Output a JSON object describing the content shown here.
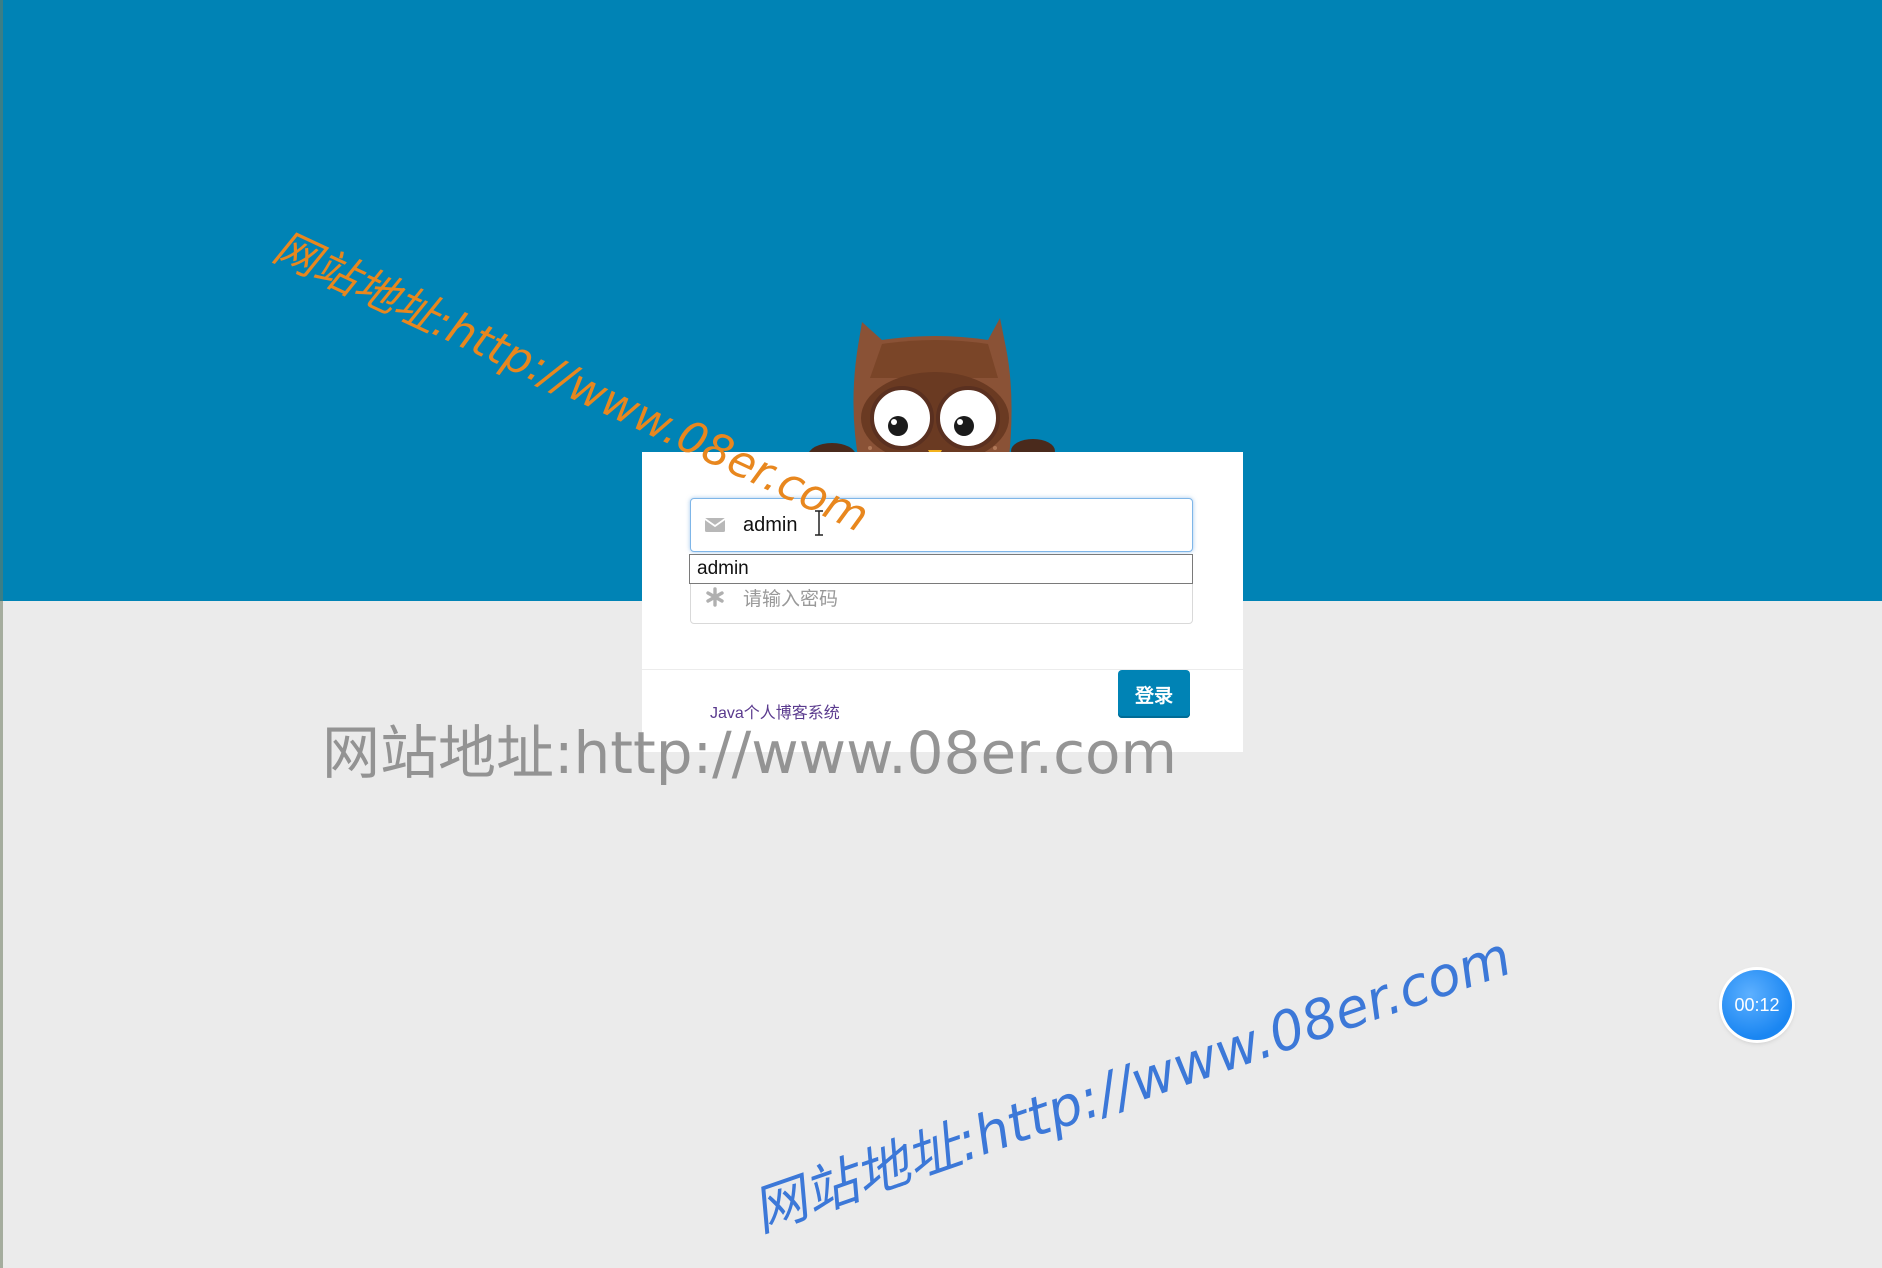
{
  "login_form": {
    "username_value": "admin",
    "password_placeholder": "请输入密码",
    "autocomplete_suggestion": "admin",
    "footer_link": "Java个人博客系统",
    "login_button": "登录"
  },
  "watermarks": {
    "orange": "网站地址:http://www.08er.com",
    "gray": "网站地址:http://www.08er.com",
    "blue": "网站地址:http://www.08er.com"
  },
  "timer": {
    "label": "00:12"
  },
  "icons": {
    "username": "envelope-icon",
    "password": "asterisk-icon"
  },
  "colors": {
    "header_band": "#0083b5",
    "background": "#ebebeb",
    "button": "#0083b5"
  }
}
